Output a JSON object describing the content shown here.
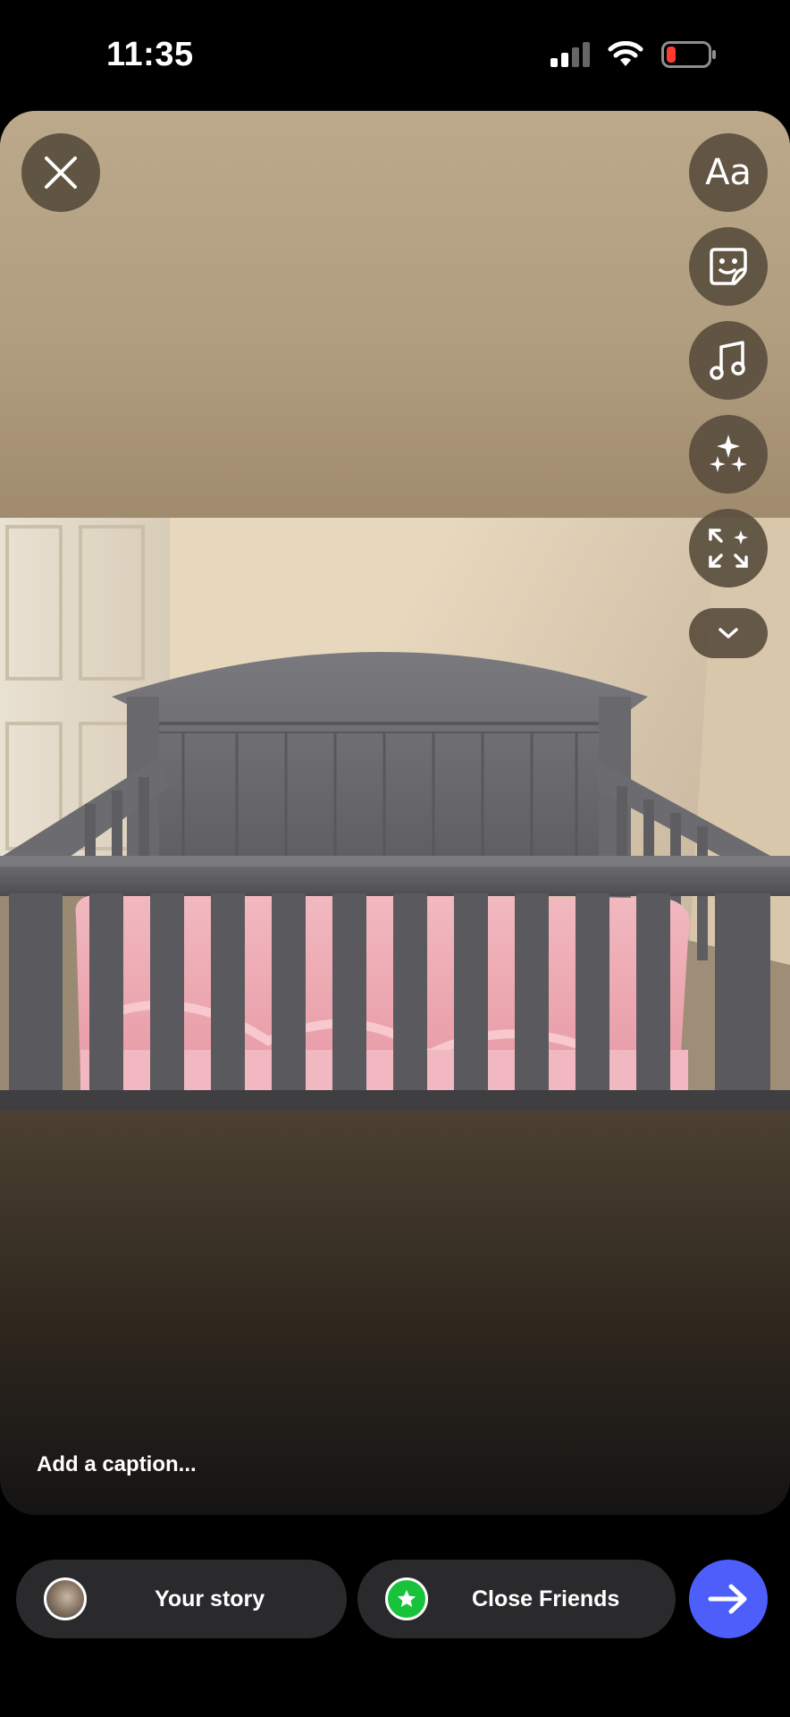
{
  "status_bar": {
    "time": "11:35",
    "battery_color": "#ff3b30"
  },
  "editor": {
    "tools": [
      {
        "name": "text-tool",
        "label": "Aa"
      },
      {
        "name": "sticker-tool",
        "icon": "sticker-icon"
      },
      {
        "name": "music-tool",
        "icon": "music-note-icon"
      },
      {
        "name": "effects-tool",
        "icon": "sparkles-icon"
      },
      {
        "name": "resize-tool",
        "icon": "expand-icon"
      },
      {
        "name": "more-tools",
        "icon": "chevron-down-icon"
      }
    ],
    "caption_placeholder": "Add a caption..."
  },
  "share": {
    "your_story_label": "Your story",
    "close_friends_label": "Close Friends",
    "close_friends_color": "#18c33b",
    "send_color": "#4d5efb"
  }
}
